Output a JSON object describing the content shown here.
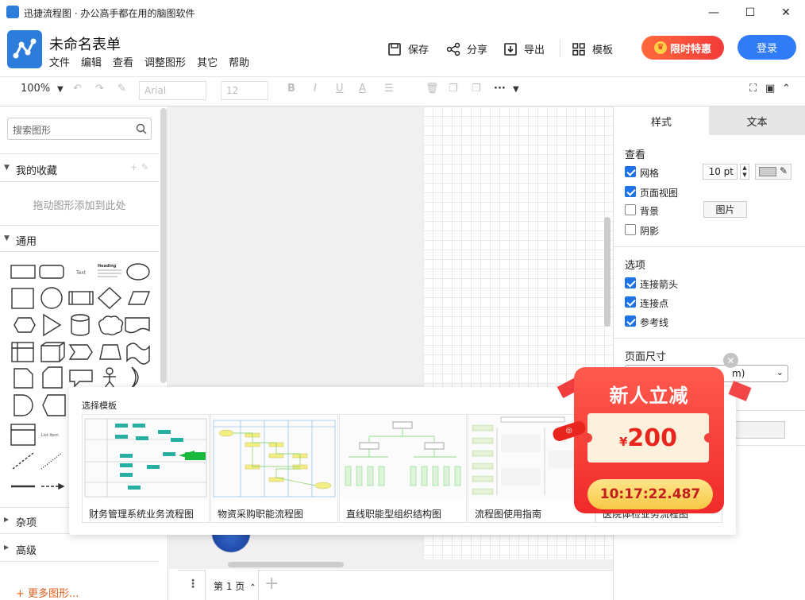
{
  "window": {
    "title": "迅捷流程图 · 办公高手都在用的脑图软件"
  },
  "header": {
    "doc_title": "未命名表单",
    "menu": [
      "文件",
      "编辑",
      "查看",
      "调整图形",
      "其它",
      "帮助"
    ],
    "save": "保存",
    "share": "分享",
    "export": "导出",
    "template": "模板",
    "promo": "限时特惠",
    "login": "登录"
  },
  "format": {
    "zoom": "100%",
    "font": "Arial",
    "size": "12"
  },
  "left": {
    "search_placeholder": "搜索图形",
    "favorites": "我的收藏",
    "drag_tip": "拖动图形添加到此处",
    "general": "通用",
    "misc": "杂项",
    "advanced": "高级",
    "more": "更多图形...",
    "shape_text": "Text",
    "shape_heading": "Heading"
  },
  "page": {
    "tab": "第 1 页"
  },
  "right": {
    "tab_style": "样式",
    "tab_text": "文本",
    "view_title": "查看",
    "grid": "网格",
    "page_view": "页面视图",
    "background": "背景",
    "shadow": "阴影",
    "grid_size": "10 pt",
    "image_button": "图片",
    "options_title": "选项",
    "connect_arrow": "连接箭头",
    "connect_point": "连接点",
    "guide": "参考线",
    "page_size_title": "页面尺寸",
    "page_size_value": "m)"
  },
  "templates": {
    "title": "选择模板",
    "items": [
      "财务管理系统业务流程图",
      "物资采购职能流程图",
      "直线职能型组织结构图",
      "流程图使用指南",
      "医院体检业务流程图"
    ]
  },
  "coupon": {
    "title": "新人立减",
    "currency": "¥",
    "amount": "200",
    "timer": "10:17:22.487"
  }
}
